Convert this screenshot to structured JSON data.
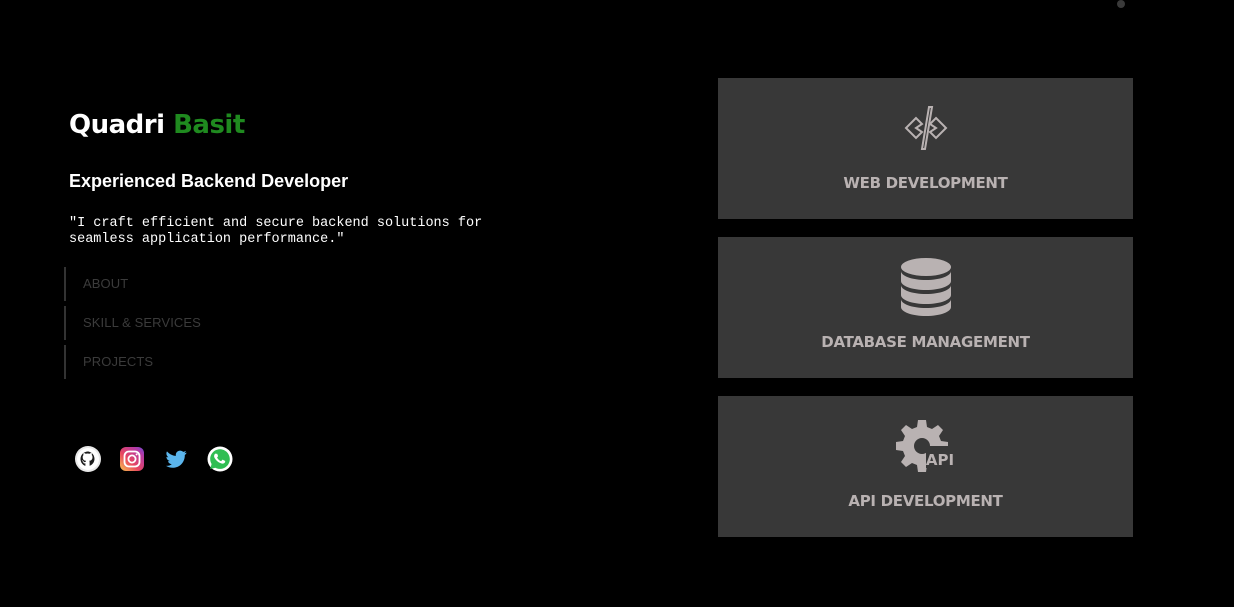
{
  "header": {
    "first_name": "Quadri",
    "last_name": "Basit",
    "accent_color": "#1f8a1f"
  },
  "tagline": "Experienced Backend Developer",
  "quote": "\"I craft efficient and secure backend solutions for seamless application performance.\"",
  "nav": {
    "items": [
      {
        "label": "ABOUT"
      },
      {
        "label": "SKILL & SERVICES"
      },
      {
        "label": "PROJECTS"
      }
    ]
  },
  "socials": [
    {
      "icon": "github-icon"
    },
    {
      "icon": "instagram-icon"
    },
    {
      "icon": "twitter-icon"
    },
    {
      "icon": "whatsapp-icon"
    }
  ],
  "services": [
    {
      "icon": "code-icon",
      "title": "WEB DEVELOPMENT"
    },
    {
      "icon": "database-icon",
      "title": "DATABASE MANAGEMENT"
    },
    {
      "icon": "api-gear-icon",
      "title": "API DEVELOPMENT",
      "icon_text": "API"
    }
  ],
  "colors": {
    "background": "#000000",
    "card_background": "#383838",
    "card_text": "#b9b2b2",
    "nav_text": "#3b3b3b"
  }
}
